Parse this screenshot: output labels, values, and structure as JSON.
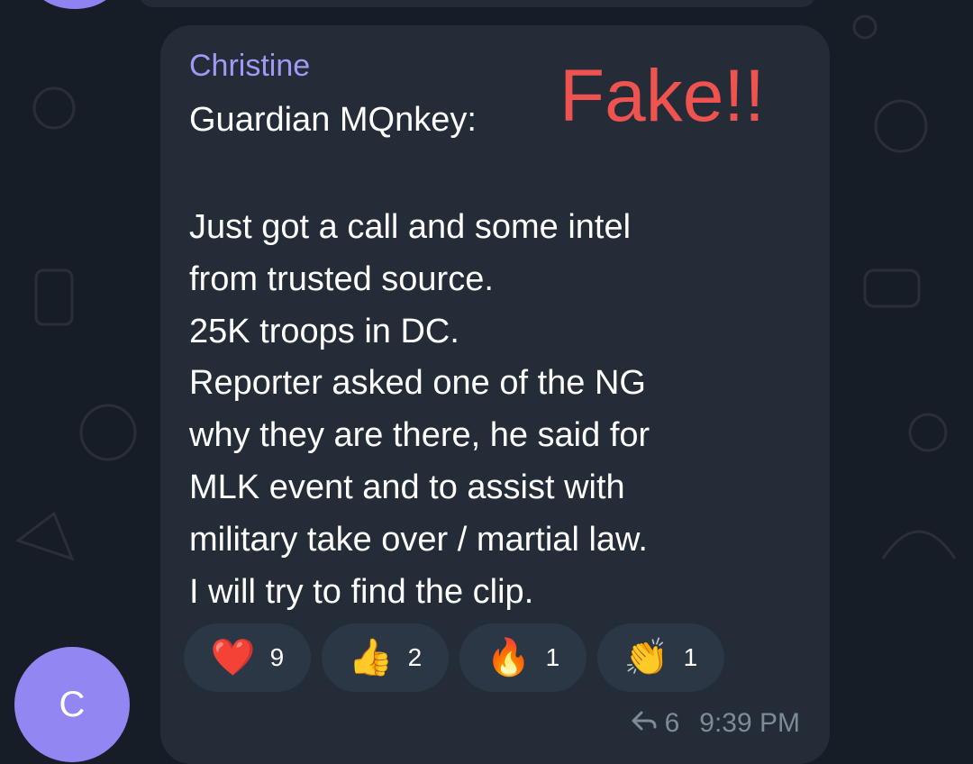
{
  "message": {
    "sender": "Christine",
    "forward_prefix": "Guardian MQnkey:",
    "sticker_text": "Fake!!",
    "lines": [
      "Just got a call and some intel",
      "from trusted source.",
      "25K troops in DC.",
      "Reporter asked one of the NG",
      "why they are there, he said for",
      "MLK event and to assist with",
      "military take over / martial law.",
      "I will try to find the clip."
    ],
    "reactions": [
      {
        "emoji": "❤️",
        "icon": "red-heart-icon",
        "count": "9"
      },
      {
        "emoji": "👍",
        "icon": "thumbs-up-icon",
        "count": "2"
      },
      {
        "emoji": "🔥",
        "icon": "fire-icon",
        "count": "1"
      },
      {
        "emoji": "👏",
        "icon": "clapping-hands-icon",
        "count": "1"
      }
    ],
    "reply_count": "6",
    "time": "9:39 PM"
  },
  "avatar": {
    "initial": "C"
  },
  "colors": {
    "background": "#171d26",
    "bubble": "#232c37",
    "sender": "#a09af5",
    "sticker": "#ef5350",
    "avatar": "#9287f2",
    "reaction_bg": "#2c3745",
    "meta": "#7f8a98"
  }
}
